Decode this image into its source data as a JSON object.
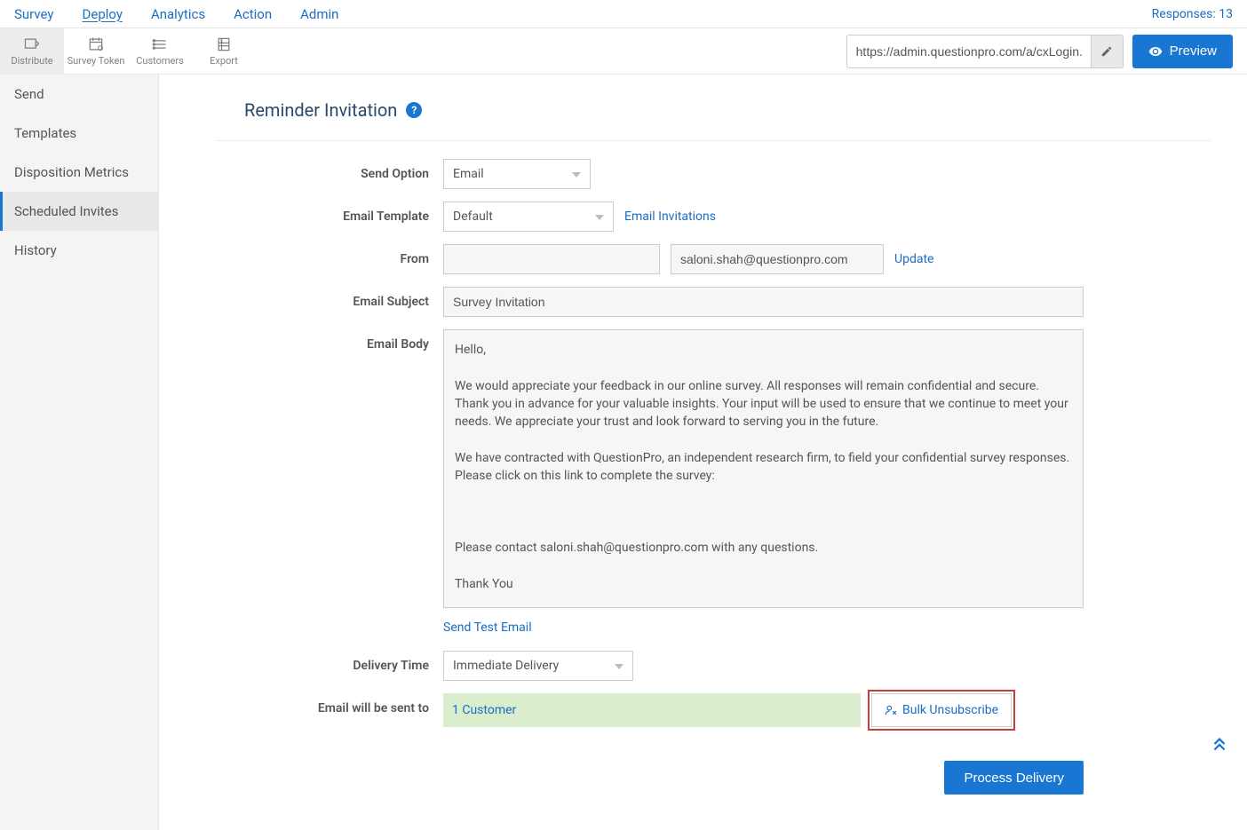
{
  "topnav": {
    "tabs": [
      "Survey",
      "Deploy",
      "Analytics",
      "Action",
      "Admin"
    ],
    "active": 1,
    "responses_label": "Responses: 13"
  },
  "toolbar": {
    "items": [
      {
        "label": "Distribute",
        "icon": "distribute"
      },
      {
        "label": "Survey Token",
        "icon": "calendar"
      },
      {
        "label": "Customers",
        "icon": "customers"
      },
      {
        "label": "Export",
        "icon": "export"
      }
    ],
    "active": 0,
    "url": "https://admin.questionpro.com/a/cxLogin.do",
    "preview_label": "Preview"
  },
  "sidebar": {
    "items": [
      "Send",
      "Templates",
      "Disposition Metrics",
      "Scheduled Invites",
      "History"
    ],
    "active": 3
  },
  "page": {
    "title": "Reminder Invitation"
  },
  "form": {
    "send_option": {
      "label": "Send Option",
      "value": "Email"
    },
    "email_template": {
      "label": "Email Template",
      "value": "Default",
      "link": "Email Invitations"
    },
    "from": {
      "label": "From",
      "name_value": "",
      "email_value": "saloni.shah@questionpro.com",
      "update": "Update"
    },
    "subject": {
      "label": "Email Subject",
      "value": "Survey Invitation"
    },
    "body": {
      "label": "Email Body",
      "value": "Hello,\n\nWe would appreciate your feedback in our online survey. All responses will remain confidential and secure. Thank you in advance for your valuable insights. Your input will be used to ensure that we continue to meet your needs. We appreciate your trust and look forward to serving you in the future.\n\nWe have contracted with QuestionPro, an independent research firm, to field your confidential survey responses. Please click on this link to complete the survey:\n\n\n\nPlease contact saloni.shah@questionpro.com with any questions.\n\nThank You"
    },
    "send_test": "Send Test Email",
    "delivery_time": {
      "label": "Delivery Time",
      "value": "Immediate Delivery"
    },
    "recipients": {
      "label": "Email will be sent to",
      "value": "1 Customer"
    },
    "bulk_unsubscribe": "Bulk Unsubscribe",
    "process": "Process Delivery"
  }
}
